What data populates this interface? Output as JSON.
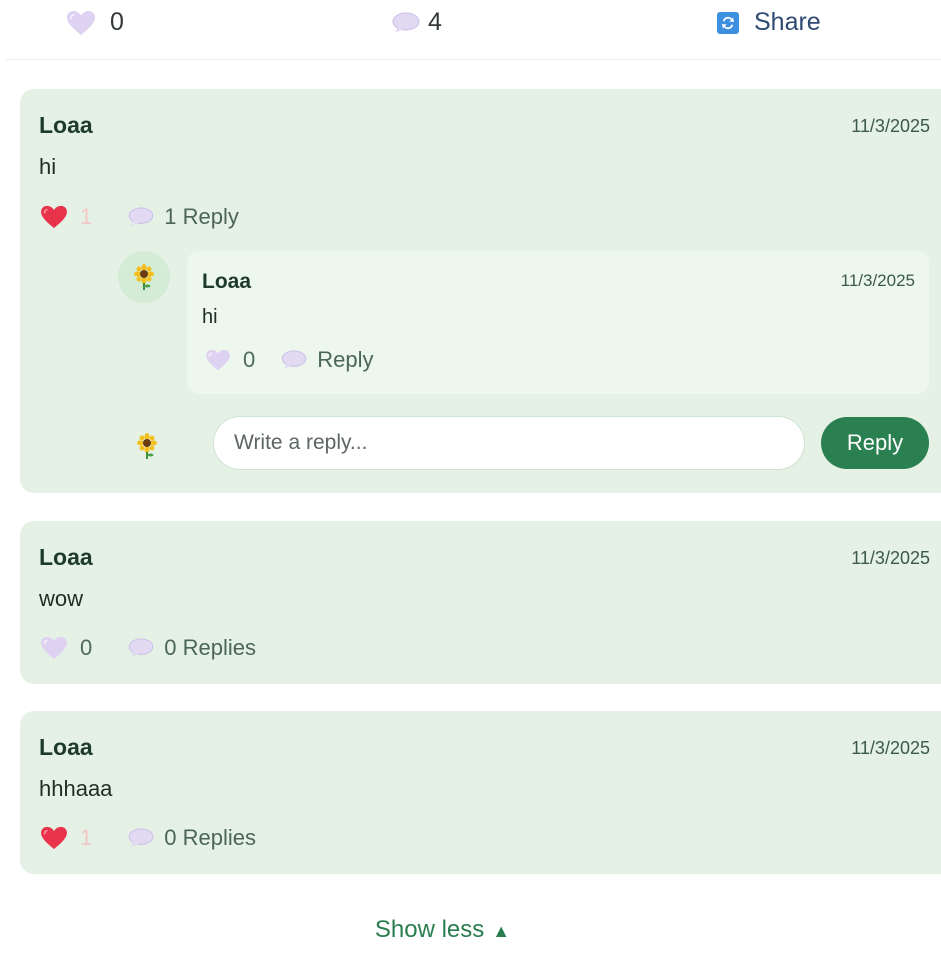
{
  "post_actions": {
    "likes": "0",
    "comments": "4",
    "share_label": "Share"
  },
  "comments": [
    {
      "author": "Loaa",
      "date": "11/3/2025",
      "text": "hi",
      "likes": "1",
      "liked": true,
      "replies_label": "1 Reply",
      "replies": [
        {
          "author": "Loaa",
          "date": "11/3/2025",
          "text": "hi",
          "likes": "0",
          "reply_label": "Reply"
        }
      ],
      "reply_form": {
        "placeholder": "Write a reply...",
        "button": "Reply"
      }
    },
    {
      "author": "Loaa",
      "date": "11/3/2025",
      "text": "wow",
      "likes": "0",
      "liked": false,
      "replies_label": "0 Replies"
    },
    {
      "author": "Loaa",
      "date": "11/3/2025",
      "text": "hhhaaa",
      "likes": "1",
      "liked": true,
      "replies_label": "0 Replies"
    }
  ],
  "show_less": {
    "label": "Show less",
    "arrow": "▲"
  },
  "icons": {
    "heart_empty": "heart-outline-icon",
    "heart_filled": "heart-filled-icon",
    "comment": "speech-bubble-icon",
    "share": "share-icon",
    "avatar": "sunflower-icon"
  },
  "colors": {
    "card_bg": "#e5f1e5",
    "reply_bg": "#eef7ee",
    "accent_green": "#2a8050",
    "heart_red": "#e8334a",
    "heart_lavender": "#d9cdf0"
  }
}
